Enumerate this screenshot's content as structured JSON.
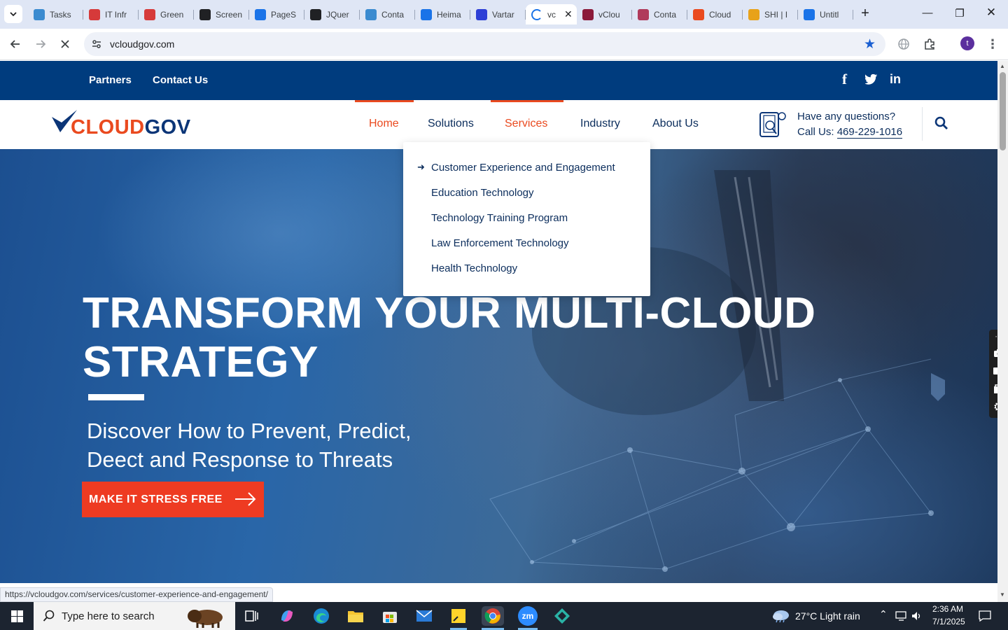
{
  "browser": {
    "tabs": [
      {
        "title": "Tasks",
        "color": "#3b8bd0"
      },
      {
        "title": "IT Infr",
        "color": "#d63a3a"
      },
      {
        "title": "Green",
        "color": "#d63a3a"
      },
      {
        "title": "Screen",
        "color": "#202124"
      },
      {
        "title": "PageS",
        "color": "#1a73e8"
      },
      {
        "title": "JQuer",
        "color": "#202124"
      },
      {
        "title": "Conta",
        "color": "#3b8bd0"
      },
      {
        "title": "Heima",
        "color": "#1a73e8"
      },
      {
        "title": "Vartar",
        "color": "#2d3fd6"
      },
      {
        "title": "vc",
        "color": "#1a73e8"
      },
      {
        "title": "vClou",
        "color": "#8b1a3a"
      },
      {
        "title": "Conta",
        "color": "#b03a5b"
      },
      {
        "title": "Cloud",
        "color": "#ea4a1f"
      },
      {
        "title": "SHI | I",
        "color": "#e8a21a"
      },
      {
        "title": "Untitl",
        "color": "#1a73e8"
      }
    ],
    "active_tab_index": 9,
    "url": "vcloudgov.com",
    "profile_initial": "t",
    "status_url": "https://vcloudgov.com/services/customer-experience-and-engagement/"
  },
  "site": {
    "topbar": {
      "links": [
        "Partners",
        "Contact Us"
      ],
      "social": [
        "f",
        "twitter",
        "in"
      ]
    },
    "logo": {
      "part1": "CLOUD",
      "part2": "GOV"
    },
    "nav": {
      "home": "Home",
      "solutions": "Solutions",
      "services": "Services",
      "industry": "Industry",
      "about": "About Us"
    },
    "contact": {
      "question": "Have any questions?",
      "call_prefix": "Call Us: ",
      "phone": "469-229-1016"
    },
    "services_menu": [
      "Customer Experience and Engagement",
      "Education Technology",
      "Technology Training Program",
      "Law Enforcement Technology",
      "Health Technology"
    ],
    "hero": {
      "title_line1": "TRANSFORM YOUR MULTI-CLOUD",
      "title_line2": "STRATEGY",
      "subtitle_line1": "Discover How to Prevent, Predict,",
      "subtitle_line2": "Deect and Response to Threats",
      "cta": "MAKE IT STRESS FREE"
    },
    "colors": {
      "navy": "#003c7e",
      "accent": "#ea4a1f",
      "cta": "#ee3b22"
    }
  },
  "taskbar": {
    "search_placeholder": "Type here to search",
    "weather": "27°C  Light rain",
    "time": "2:36 AM",
    "date": "7/1/2025"
  }
}
